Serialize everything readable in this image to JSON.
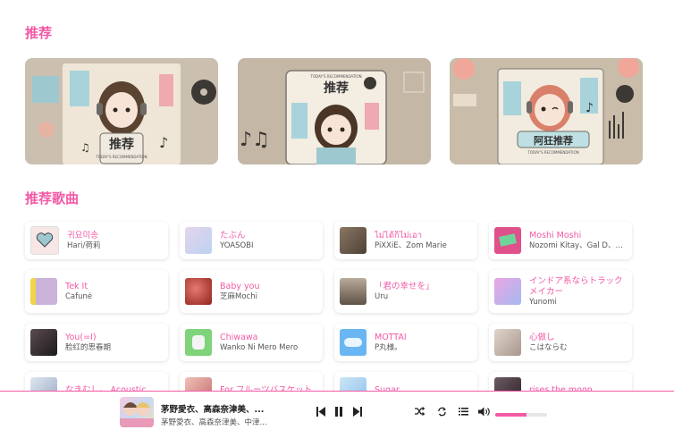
{
  "sections": {
    "recommend_title": "推荐",
    "songs_title": "推荐歌曲"
  },
  "banners": [
    {
      "label": "推荐",
      "subtitle": "TODAY'S RECOMMENDATION"
    },
    {
      "label": "推荐",
      "subtitle": "TODAY'S RECOMMENDATION"
    },
    {
      "label": "阿狂推荐",
      "subtitle": "TODAY'S RECOMMENDATION"
    }
  ],
  "songs": [
    {
      "title": "귀요미송",
      "artist": "Hari/荷莉",
      "cover": "#f4e3e3"
    },
    {
      "title": "たぶん",
      "artist": "YOASOBI",
      "cover": "#d9c8e6"
    },
    {
      "title": "ไม่ได้ก็ไม่เอา",
      "artist": "PiXXiE、Zom Marie",
      "cover": "#6b5a4a"
    },
    {
      "title": "Moshi Moshi",
      "artist": "Nozomi Kitay、Gal D、百足",
      "cover": "#e0508a"
    },
    {
      "title": "Tek It",
      "artist": "Cafuné",
      "cover": "#c9b3d9"
    },
    {
      "title": "Baby you",
      "artist": "芝麻Mochi",
      "cover": "#b3332f"
    },
    {
      "title": "「君の幸せを」",
      "artist": "Uru",
      "cover": "#8a7a6a"
    },
    {
      "title": "インドア系ならトラックメイカー",
      "artist": "Yunomi",
      "cover": "#d69ad9"
    },
    {
      "title": "You(=I)",
      "artist": "脸红的思春期",
      "cover": "#3a3438"
    },
    {
      "title": "Chiwawa",
      "artist": "Wanko Ni Mero Mero",
      "cover": "#7fd37a"
    },
    {
      "title": "MOTTAI",
      "artist": "P丸様。",
      "cover": "#6ab6f2"
    },
    {
      "title": "心做し",
      "artist": "こはならむ",
      "cover": "#c8b8b0"
    },
    {
      "title": "なきむし。 Acoustic",
      "artist": "",
      "cover": "#b8c4d6"
    },
    {
      "title": "For フルーツバスケット",
      "artist": "",
      "cover": "#d88c8c"
    },
    {
      "title": "Sugar",
      "artist": "",
      "cover": "#a8d0f0"
    },
    {
      "title": "rises the moon",
      "artist": "",
      "cover": "#4a3a42"
    }
  ],
  "player": {
    "title": "茅野愛衣、高森奈津美、...",
    "artist": "茅野愛衣、高森奈津美、中津...",
    "volume": 0.6
  },
  "colors": {
    "accent": "#f25aa6"
  }
}
